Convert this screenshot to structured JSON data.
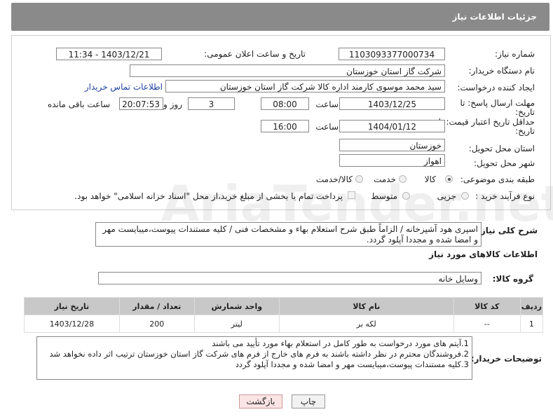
{
  "header": {
    "title": "جزئیات اطلاعات نیاز"
  },
  "form": {
    "need_number": {
      "label": "شماره نیاز:",
      "value": "1103093377000734"
    },
    "announce_datetime": {
      "label": "تاریخ و ساعت اعلان عمومی:",
      "value": "1403/12/21 - 11:34"
    },
    "buyer_org": {
      "label": "نام دستگاه خریدار:",
      "value": "شرکت گاز استان خوزستان"
    },
    "requester": {
      "label": "ایجاد کننده درخواست:",
      "value": "سید محمد موسوی کارمند اداره کالا شرکت گاز استان خوزستان",
      "contact_link": "اطلاعات تماس خریدار"
    },
    "deadline": {
      "label_line1": "مهلت ارسال پاسخ: تا",
      "label_line2": "تاریخ:",
      "date": "1403/12/25",
      "time_label": "ساعت",
      "time": "08:00",
      "days": "3",
      "days_label": "روز و",
      "remaining": "20:07:53",
      "remaining_label": "ساعت باقی مانده"
    },
    "validity": {
      "label_line1": "حداقل تاریخ اعتبار قیمت: تا",
      "label_line2": "تاریخ:",
      "date": "1404/01/12",
      "time_label": "ساعت",
      "time": "16:00"
    },
    "province": {
      "label": "استان محل تحویل:",
      "value": "خوزستان"
    },
    "city": {
      "label": "شهر محل تحویل:",
      "value": "اهواز"
    },
    "category": {
      "label": "طبقه بندی موضوعی:",
      "options": [
        "کالا",
        "خدمت",
        "کالا/خدمت"
      ],
      "selected": "کالا"
    },
    "purchase_type": {
      "label": "نوع فرآیند خرید :",
      "options": [
        "جزیی",
        "متوسط"
      ],
      "selected": "",
      "payment_note": "پرداخت تمام یا بخشی از مبلغ خرید،از محل \"اسناد خزانه اسلامی\" خواهد بود."
    }
  },
  "description": {
    "label": "شرح كلی نیاز:",
    "text": "اسپری هود آشپزخانه / الزاماً طبق شرح استعلام بهاء و مشخصات فنی / کلیه مستندات پیوست،میبایست مهر و امضا شده و مجددا آپلود گردد."
  },
  "goods": {
    "section_title": "اطلاعات کالاهای مورد نیاز",
    "group_label": "گروه کالا:",
    "group_value": "وسایل خانه",
    "columns": [
      "ردیف",
      "کد کالا",
      "نام کالا",
      "واحد شمارش",
      "تعداد / مقدار",
      "تاریخ نیاز"
    ],
    "rows": [
      [
        "1",
        "--",
        "لکه بر",
        "لیتر",
        "200",
        "1403/12/28"
      ]
    ]
  },
  "buyer_notes": {
    "label": "توضیحات خریدار:",
    "lines": [
      "1.آیتم های مورد درخواست به طور کامل در استعلام بهاء مورد تأیید می باشند",
      "2.فروشندگان محترم در نظر داشته باشند به فرم های خارج از فرم های شرکت گاز استان خوزستان ترتیب اثر داده نخواهد شد",
      "3.کلیه مستندات پیوست،میبایست مهر و امضا شده و مجددا آپلود گردد"
    ]
  },
  "buttons": {
    "print": "چاپ",
    "back": "بازگشت"
  },
  "watermark": "AriaTender.net"
}
